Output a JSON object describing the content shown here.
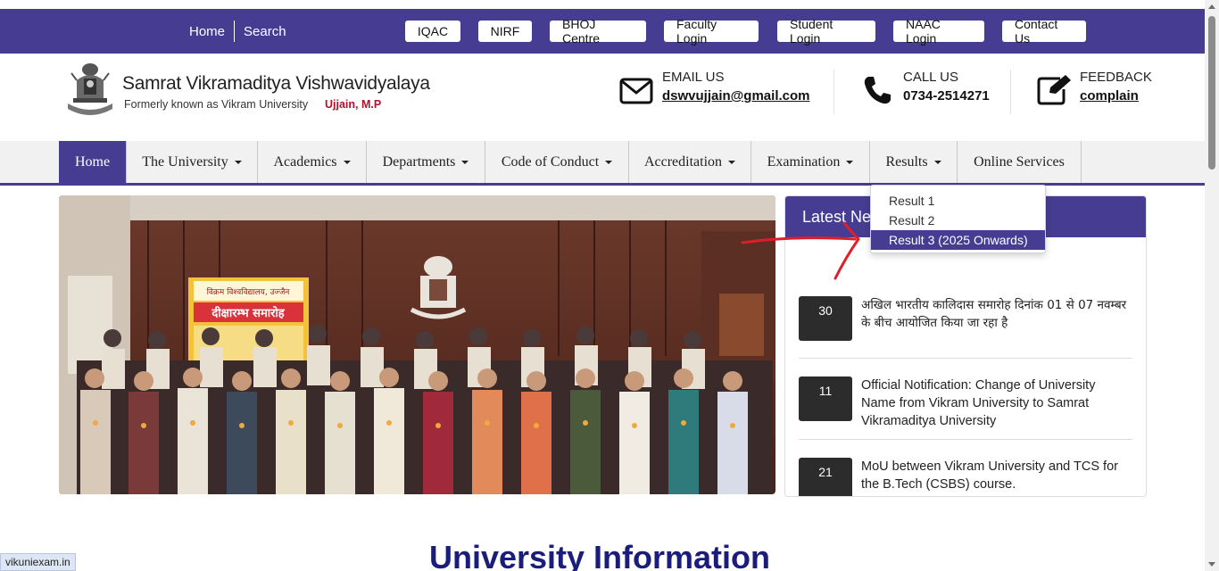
{
  "topbar": {
    "home": "Home",
    "search": "Search",
    "buttons": [
      "IQAC",
      "NIRF",
      "BHOJ Centre",
      "Faculty Login",
      "Student Login",
      "NAAC Login",
      "Contact Us"
    ]
  },
  "brand": {
    "title": "Samrat Vikramaditya Vishwavidyalaya",
    "subtitle": "Formerly known as Vikram University",
    "location": "Ujjain, M.P"
  },
  "contacts": {
    "email": {
      "label": "EMAIL US",
      "value": "dswvujjain@gmail.com"
    },
    "call": {
      "label": "CALL US",
      "value": "0734-2514271"
    },
    "feedback": {
      "label": "FEEDBACK",
      "value": "complain"
    }
  },
  "nav": {
    "items": [
      "Home",
      "The University",
      "Academics",
      "Departments",
      "Code of Conduct",
      "Accreditation",
      "Examination",
      "Results",
      "Online Services"
    ]
  },
  "results_dropdown": {
    "items": [
      "Result 1",
      "Result 2",
      "Result 3 (2025 Onwards)"
    ],
    "highlighted": "Result 3 (2025 Onwards)"
  },
  "banner": {
    "banner_line1": "विक्रम विश्वविद्यालय, उज्जैन",
    "banner_line2": "दीक्षारम्भ समारोह"
  },
  "news": {
    "heading": "Latest Ne",
    "items": [
      {
        "day": "30",
        "text": "अखिल भारतीय कालिदास समारोह दिनांक 01 से 07 नवम्बर के बीच आयोजित किया जा रहा है"
      },
      {
        "day": "11",
        "text": "Official Notification: Change of University Name from Vikram University to Samrat Vikramaditya University"
      },
      {
        "day": "21",
        "text": "MoU between Vikram University and TCS for the B.Tech (CSBS) course."
      }
    ]
  },
  "section_title": "University Information",
  "status_url": "vikuniexam.in",
  "colors": {
    "brand": "#463d92",
    "annotation": "#e21d2a",
    "heading": "#1b1d7a"
  }
}
